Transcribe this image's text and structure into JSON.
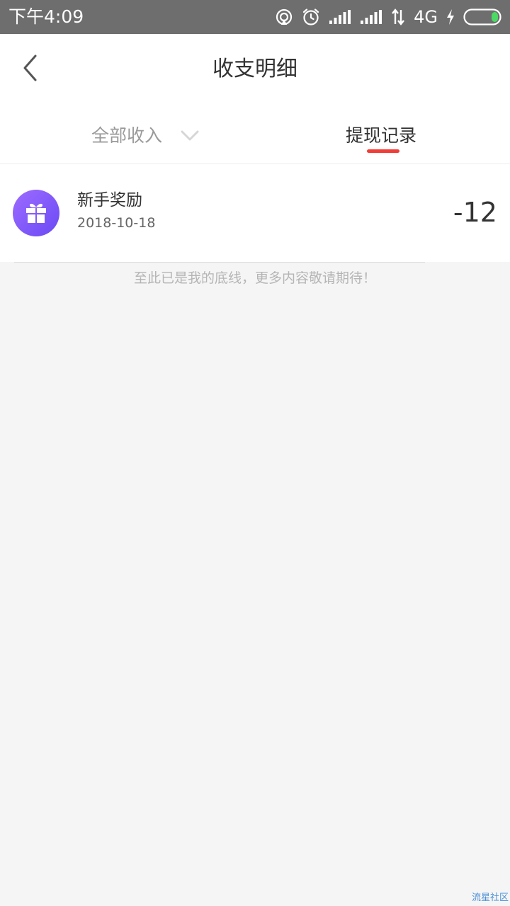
{
  "status_bar": {
    "time": "下午4:09",
    "network": "4G",
    "icons": [
      "hotspot-icon",
      "alarm-icon",
      "signal-icon",
      "signal-icon",
      "data-transfer-icon",
      "charging-icon",
      "battery-icon"
    ]
  },
  "header": {
    "back_icon": "chevron-left-icon",
    "title": "收支明细"
  },
  "tabs": {
    "all_income": "全部收入",
    "withdraw_records": "提现记录",
    "active": "withdraw_records",
    "accent_color": "#f23c37"
  },
  "records": [
    {
      "icon": "gift-icon",
      "title": "新手奖励",
      "date": "2018-10-18",
      "amount": "-12"
    }
  ],
  "end_note": "至此已是我的底线，更多内容敬请期待！",
  "watermark": "流星社区"
}
